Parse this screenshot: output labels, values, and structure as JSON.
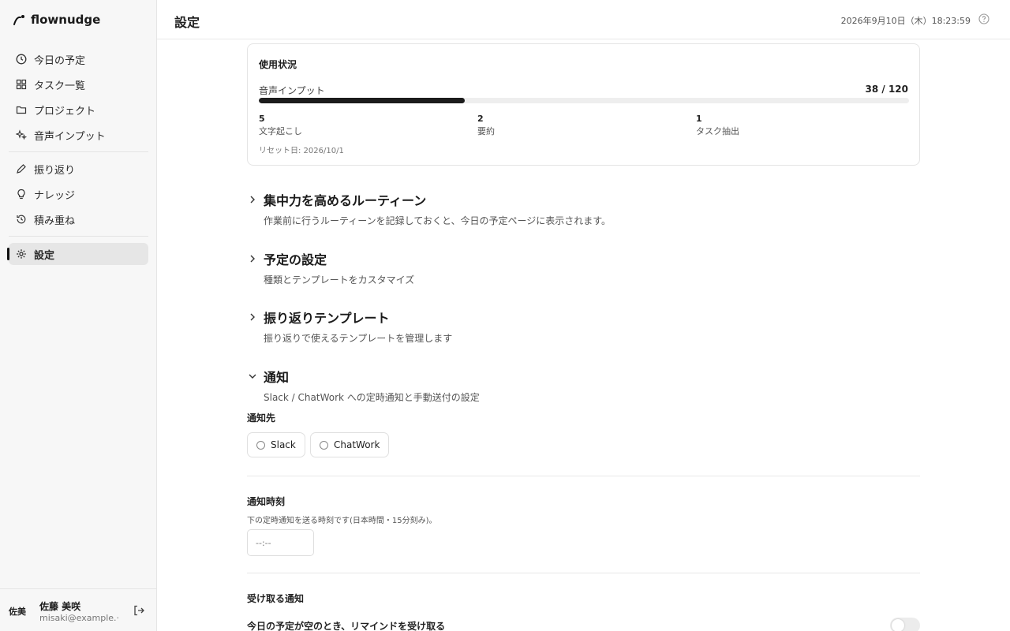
{
  "brand": {
    "name": "flownudge",
    "icon": "flow-logo-icon"
  },
  "sidebar": {
    "items": [
      {
        "label": "今日の予定",
        "icon": "clock-icon"
      },
      {
        "label": "タスク一覧",
        "icon": "grid-icon"
      },
      {
        "label": "プロジェクト",
        "icon": "folder-icon"
      },
      {
        "label": "音声インプット",
        "icon": "sparkles-icon"
      },
      {
        "label": "振り返り",
        "icon": "pencil-icon"
      },
      {
        "label": "ナレッジ",
        "icon": "lightbulb-icon"
      },
      {
        "label": "積み重ね",
        "icon": "history-icon"
      },
      {
        "label": "設定",
        "icon": "gear-icon",
        "active": true
      }
    ]
  },
  "user": {
    "avatar": "佐美",
    "name": "佐藤 美咲",
    "email": "misaki@example.···"
  },
  "header": {
    "title": "設定",
    "datetime": "2026年9月10日（木）18:23:59"
  },
  "usage": {
    "title": "使用状況",
    "label": "音声インプット",
    "count": "38 / 120",
    "progress": 0.3167,
    "stats": [
      {
        "num": "5",
        "label": "文字起こし"
      },
      {
        "num": "2",
        "label": "要約"
      },
      {
        "num": "1",
        "label": "タスク抽出"
      }
    ],
    "reset": "リセット日: 2026/10/1"
  },
  "sections": [
    {
      "title": "集中力を高めるルーティーン",
      "desc": "作業前に行うルーティーンを記録しておくと、今日の予定ページに表示されます。",
      "expanded": false
    },
    {
      "title": "予定の設定",
      "desc": "種類とテンプレートをカスタマイズ",
      "expanded": false
    },
    {
      "title": "振り返りテンプレート",
      "desc": "振り返りで使えるテンプレートを管理します",
      "expanded": false
    },
    {
      "title": "通知",
      "desc": "Slack / ChatWork への定時通知と手動送付の設定",
      "expanded": true
    }
  ],
  "notify": {
    "dest_label": "通知先",
    "options": [
      "Slack",
      "ChatWork"
    ],
    "time_label": "通知時刻",
    "time_hint": "下の定時通知を送る時刻です(日本時間・15分刻み)。",
    "time_placeholder": "--:--",
    "receive_label": "受け取る通知",
    "remind_label": "今日の予定が空のとき、リマインドを受け取る"
  }
}
